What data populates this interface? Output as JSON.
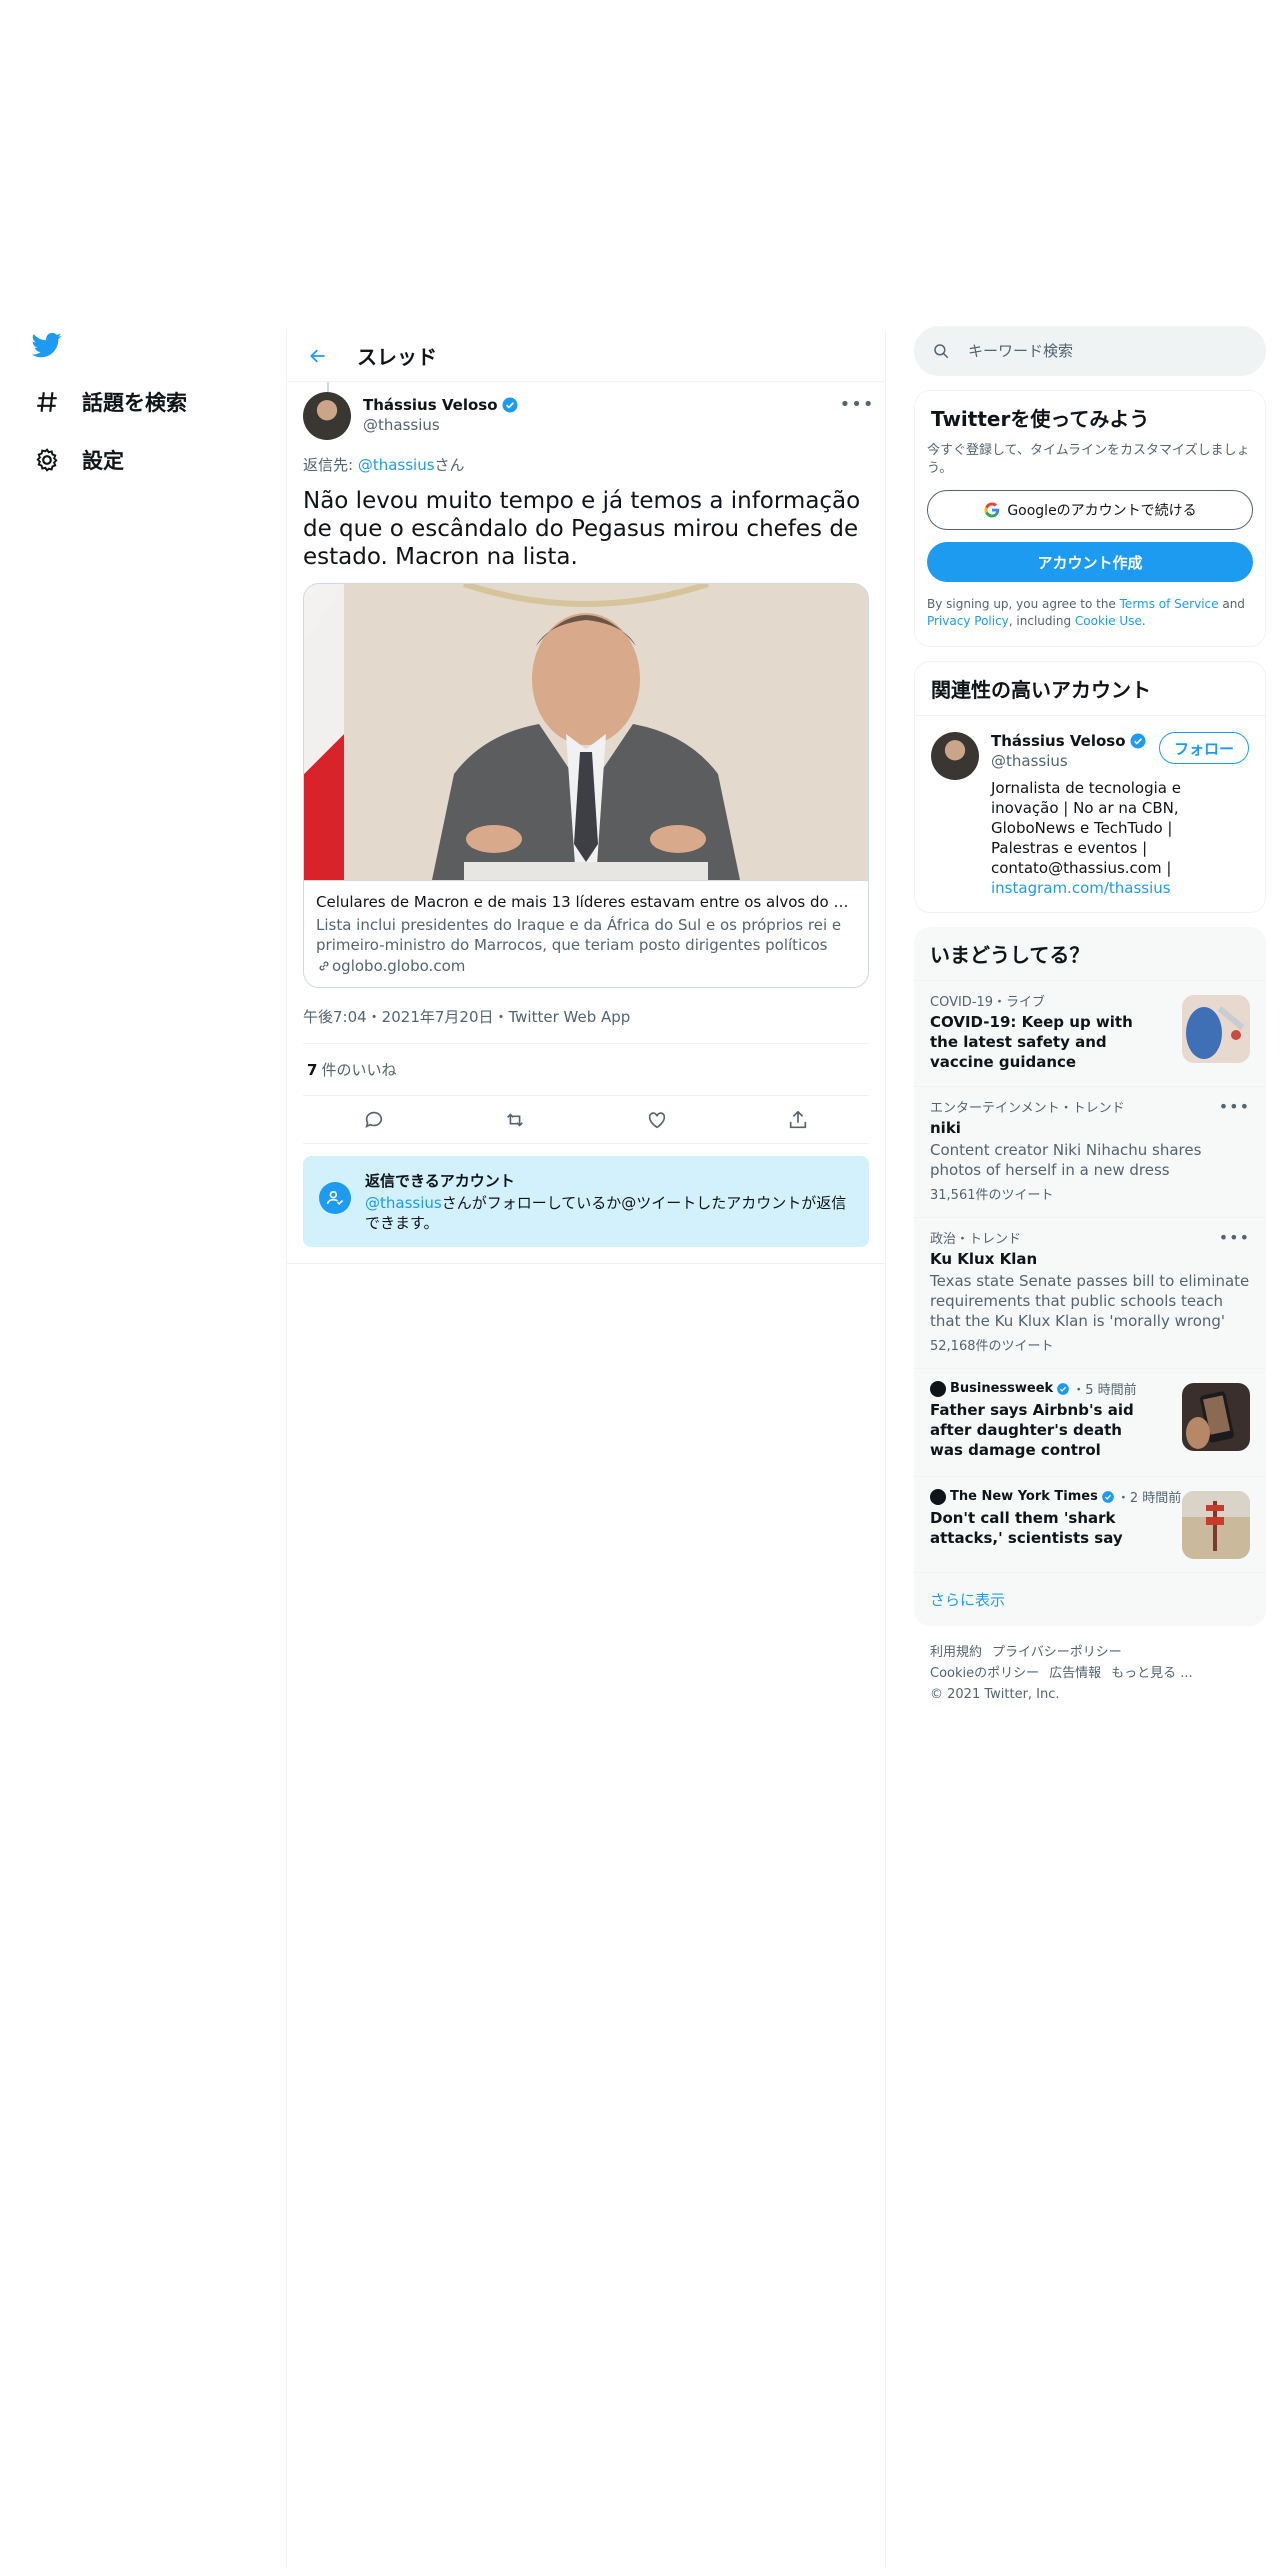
{
  "nav": {
    "items": [
      {
        "label": "話題を検索",
        "icon": "hashtag-icon"
      },
      {
        "label": "設定",
        "icon": "gear-icon"
      }
    ]
  },
  "header": {
    "title": "スレッド"
  },
  "tweet": {
    "author_name": "Thássius Veloso",
    "author_handle": "@thassius",
    "reply_prefix": "返信先: ",
    "reply_handle": "@thassius",
    "reply_suffix": "さん",
    "text": "Não levou muito tempo e já temos a informação de que o escândalo do Pegasus mirou chefes de estado. Macron na lista.",
    "card": {
      "title": "Celulares de Macron e de mais 13 líderes estavam entre os alvos do sistema ...",
      "description": "Lista inclui presidentes do Iraque e da África do Sul e os próprios rei e primeiro-ministro do Marrocos, que teriam posto dirigentes políticos franceses entre ...",
      "domain": "oglobo.globo.com"
    },
    "meta": "午後7:04・2021年7月20日・Twitter Web App",
    "likes_count": "7",
    "likes_label": "件のいいね"
  },
  "reply_restriction": {
    "title": "返信できるアカウント",
    "handle": "@thassius",
    "desc": "さんがフォローしているか@ツイートしたアカウントが返信できます。"
  },
  "search": {
    "placeholder": "キーワード検索"
  },
  "signup": {
    "title": "Twitterを使ってみよう",
    "subtitle": "今すぐ登録して、タイムラインをカスタマイズしましょう。",
    "google_button": "Googleのアカウントで続ける",
    "create_button": "アカウント作成",
    "legal_prefix": "By signing up, you agree to the ",
    "terms": "Terms of Service",
    "legal_and": " and ",
    "privacy": "Privacy Policy",
    "legal_including": ", including ",
    "cookie": "Cookie Use",
    "legal_end": "."
  },
  "related": {
    "title": "関連性の高いアカウント",
    "name": "Thássius Veloso",
    "handle": "@thassius",
    "follow_button": "フォロー",
    "bio": "Jornalista de tecnologia e inovação | No ar na CBN, GloboNews e TechTudo | Palestras e eventos | contato@thassius.com | ",
    "bio_link": "instagram.com/thassius"
  },
  "trends": {
    "title": "いまどうしてる？",
    "items": [
      {
        "category": "COVID-19・ライブ",
        "title": "COVID-19: Keep up with the latest safety and vaccine guidance"
      },
      {
        "category": "エンターテインメント・トレンド",
        "title": "niki",
        "desc": "Content creator Niki Nihachu shares photos of herself in a new dress",
        "count": "31,561件のツイート"
      },
      {
        "category": "政治・トレンド",
        "title": "Ku Klux Klan",
        "desc": "Texas state Senate passes bill to eliminate requirements that public schools teach that the Ku Klux Klan is 'morally wrong'",
        "count": "52,168件のツイート"
      },
      {
        "source": "Businessweek",
        "time": "・5 時間前",
        "title": "Father says Airbnb's aid after daughter's death was damage control"
      },
      {
        "source": "The New York Times",
        "time": "・2 時間前",
        "title": "Don't call them 'shark attacks,' scientists say"
      }
    ],
    "show_more": "さらに表示"
  },
  "footer": {
    "links": [
      "利用規約",
      "プライバシーポリシー",
      "Cookieのポリシー",
      "広告情報",
      "もっと見る ..."
    ],
    "copyright": "© 2021 Twitter, Inc."
  },
  "colors": {
    "accent": "#1d9bf0",
    "text": "#0f1419",
    "muted": "#536471",
    "reply_box_bg": "#d2f1fc"
  }
}
